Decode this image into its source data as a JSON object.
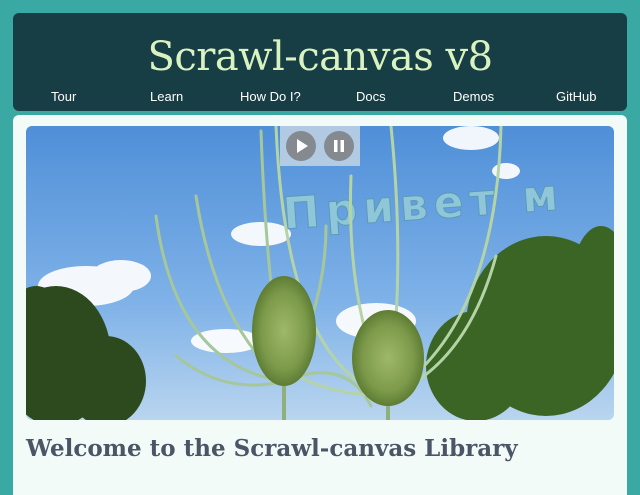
{
  "header": {
    "title": "Scrawl-canvas v8",
    "nav": [
      "Tour",
      "Learn",
      "How Do I?",
      "Docs",
      "Demos",
      "GitHub"
    ]
  },
  "hero": {
    "overlay_text": "Привет м",
    "controls": {
      "play_icon": "play-icon",
      "pause_icon": "pause-icon"
    }
  },
  "main": {
    "welcome_title": "Welcome to the Scrawl-canvas Library"
  },
  "colors": {
    "page_bg": "#3aa9a4",
    "header_bg": "#173d45",
    "title_color": "#d9f2c0",
    "content_bg": "#f3fbf8",
    "heading_color": "#4a5566"
  }
}
